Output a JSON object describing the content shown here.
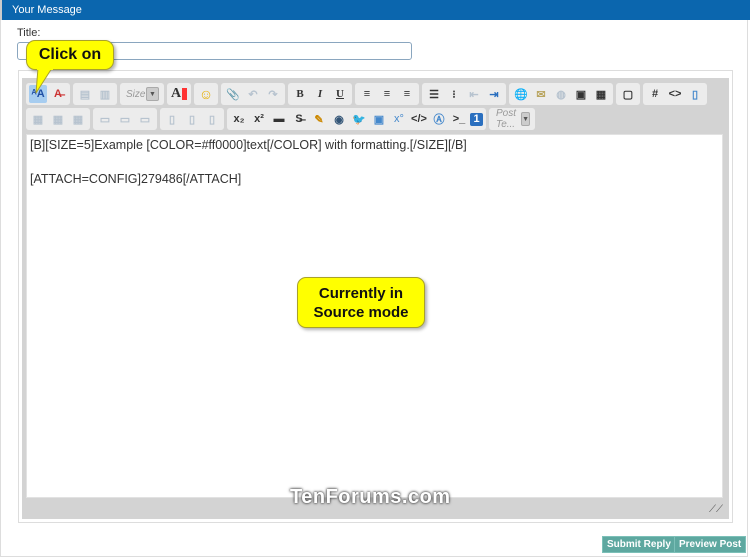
{
  "header": {
    "title": "Your Message"
  },
  "form": {
    "title_label": "Title:",
    "title_value": ""
  },
  "toolbar": {
    "row1": [
      {
        "group": [
          "source-mode",
          "remove-format"
        ]
      },
      {
        "group": [
          "paste-text",
          "paste-word"
        ]
      },
      {
        "size_select": "Size"
      },
      {
        "group": [
          "font-color"
        ]
      },
      {
        "group": [
          "smiley"
        ]
      },
      {
        "group": [
          "attach",
          "undo",
          "redo"
        ]
      },
      {
        "group": [
          "B",
          "I",
          "U"
        ]
      },
      {
        "group": [
          "align-left",
          "align-center",
          "align-right"
        ]
      },
      {
        "group": [
          "ordered-list",
          "unordered-list",
          "outdent",
          "indent"
        ]
      },
      {
        "group": [
          "link",
          "email",
          "unlink",
          "image",
          "video"
        ]
      },
      {
        "group": [
          "quote"
        ]
      },
      {
        "group": [
          "#",
          "<>",
          "php"
        ]
      }
    ],
    "post_template": "Post Te..."
  },
  "editor": {
    "content": "[B][SIZE=5]Example [COLOR=#ff0000]text[/COLOR] with formatting.[/SIZE][/B]\n\n[ATTACH=CONFIG]279486[/ATTACH]"
  },
  "buttons": {
    "submit": "Submit Reply",
    "preview": "Preview Post"
  },
  "callouts": {
    "click": "Click on",
    "mode": "Currently in Source mode"
  },
  "watermark": "TenForums.com",
  "colors": {
    "header": "#0b66ae",
    "callout": "#ffff00",
    "button": "#5ea8a0"
  }
}
